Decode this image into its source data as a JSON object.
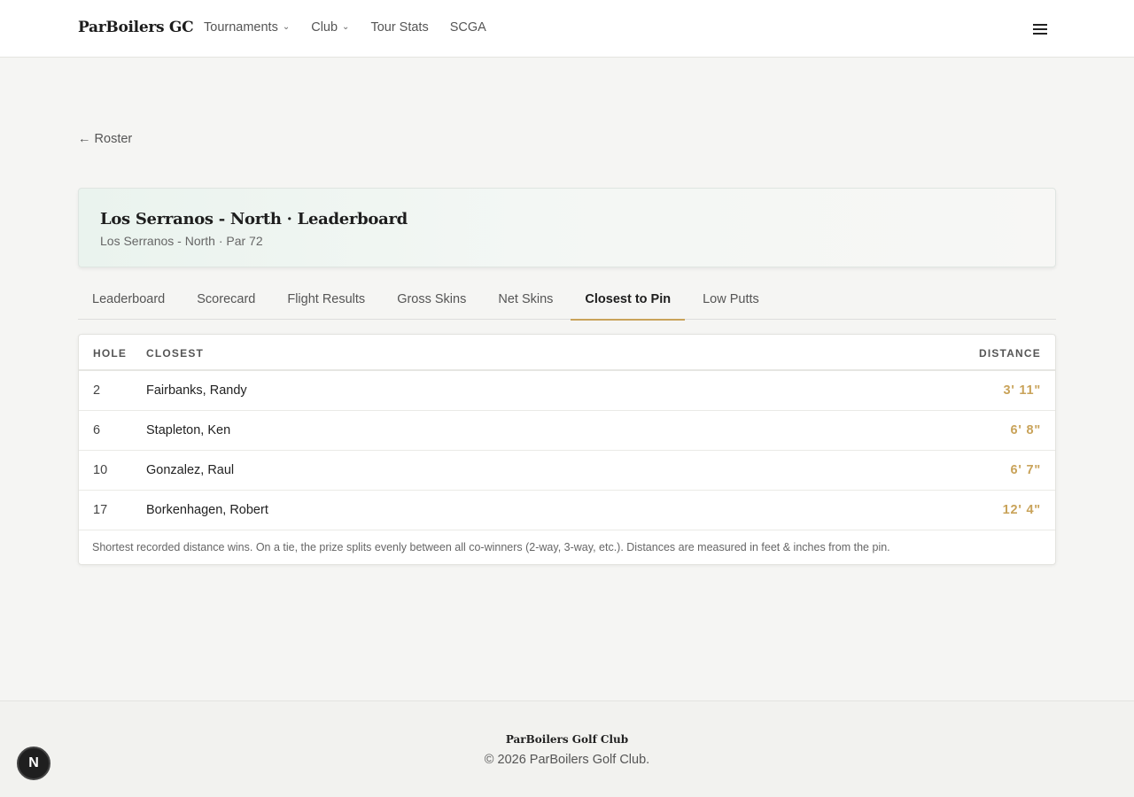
{
  "header": {
    "brand": "ParBoilers GC",
    "nav": [
      {
        "label": "Tournaments",
        "has_dropdown": true
      },
      {
        "label": "Club",
        "has_dropdown": true
      },
      {
        "label": "Tour Stats",
        "has_dropdown": false
      },
      {
        "label": "SCGA",
        "has_dropdown": false
      }
    ],
    "menu_icon": "hamburger-icon"
  },
  "back_link": "← Roster",
  "title_card": {
    "title": "Los Serranos - North · Leaderboard",
    "subtitle": "Los Serranos - North · Par 72"
  },
  "tabs": [
    {
      "label": "Leaderboard",
      "active": false
    },
    {
      "label": "Scorecard",
      "active": false
    },
    {
      "label": "Flight Results",
      "active": false
    },
    {
      "label": "Gross Skins",
      "active": false
    },
    {
      "label": "Net Skins",
      "active": false
    },
    {
      "label": "Closest to Pin",
      "active": true
    },
    {
      "label": "Low Putts",
      "active": false
    }
  ],
  "table": {
    "headers": {
      "hole": "HOLE",
      "closest": "CLOSEST",
      "distance": "DISTANCE"
    },
    "rows": [
      {
        "hole": "2",
        "closest": "Fairbanks, Randy",
        "distance": "3' 11\""
      },
      {
        "hole": "6",
        "closest": "Stapleton, Ken",
        "distance": "6' 8\""
      },
      {
        "hole": "10",
        "closest": "Gonzalez, Raul",
        "distance": "6' 7\""
      },
      {
        "hole": "17",
        "closest": "Borkenhagen, Robert",
        "distance": "12' 4\""
      }
    ],
    "note": "Shortest recorded distance wins. On a tie, the prize splits evenly between all co-winners (2-way, 3-way, etc.). Distances are measured in feet & inches from the pin."
  },
  "footer": {
    "name": "ParBoilers Golf Club",
    "copyright": "© 2026 ParBoilers Golf Club."
  },
  "badge": {
    "letter": "N"
  },
  "colors": {
    "accent": "#c9a35a",
    "background": "#f5f5f3"
  }
}
